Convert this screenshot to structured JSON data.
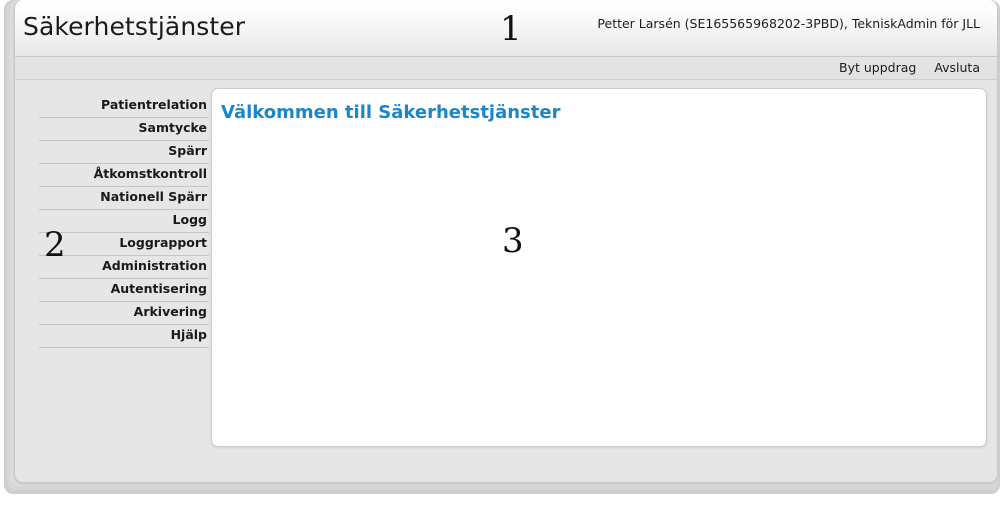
{
  "header": {
    "app_title": "Säkerhetstjänster",
    "user_info": "Petter Larsén (SE165565968202-3PBD), TekniskAdmin för JLL",
    "links": [
      {
        "label": "Byt uppdrag"
      },
      {
        "label": "Avsluta"
      }
    ]
  },
  "sidebar": {
    "items": [
      {
        "label": "Patientrelation"
      },
      {
        "label": "Samtycke"
      },
      {
        "label": "Spärr"
      },
      {
        "label": "Åtkomstkontroll"
      },
      {
        "label": "Nationell Spärr"
      },
      {
        "label": "Logg"
      },
      {
        "label": "Loggrapport"
      },
      {
        "label": "Administration"
      },
      {
        "label": "Autentisering"
      },
      {
        "label": "Arkivering"
      },
      {
        "label": "Hjälp"
      }
    ]
  },
  "content": {
    "welcome_heading": "Välkommen till Säkerhetstjänster"
  },
  "annotations": {
    "header_marker": "1",
    "sidebar_marker": "2",
    "content_marker": "3"
  },
  "colors": {
    "heading_blue": "#1a87c8",
    "page_background": "#e6e6e6",
    "panel_white": "#ffffff",
    "text_dark": "#1a1a1a",
    "separator_gray": "#c5c5c5"
  }
}
